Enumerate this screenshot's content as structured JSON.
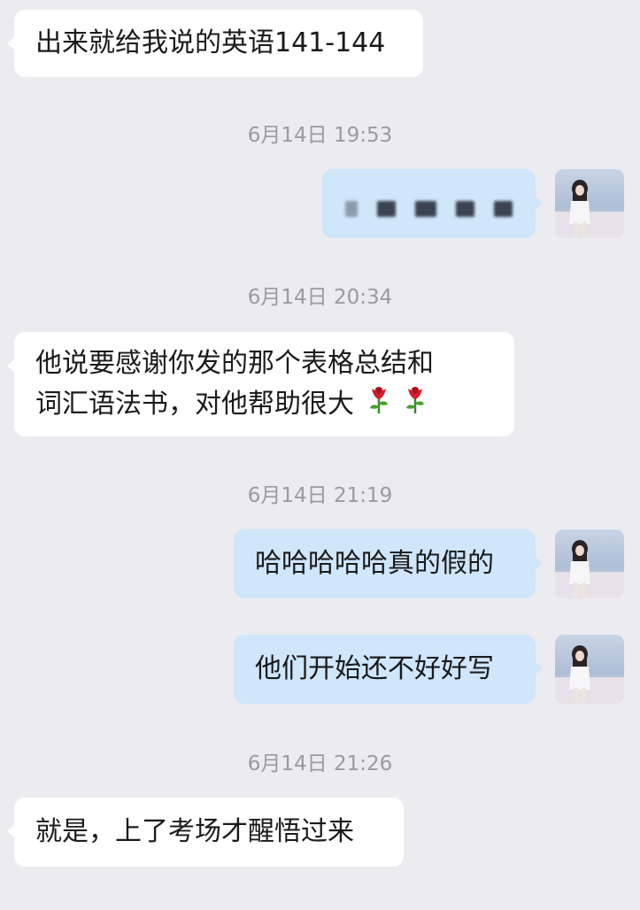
{
  "messages": [
    {
      "id": "m1",
      "side": "left",
      "lines": [
        "出来就给我说的英语141-144"
      ]
    },
    {
      "id": "t1",
      "type": "timestamp",
      "text": "6月14日 19:53"
    },
    {
      "id": "m2",
      "side": "right",
      "redacted": true
    },
    {
      "id": "t2",
      "type": "timestamp",
      "text": "6月14日 20:34"
    },
    {
      "id": "m3",
      "side": "left",
      "lines": [
        "他说要感谢你发的那个表格总结和",
        "词汇语法书，对他帮助很大"
      ],
      "emoji": [
        "rose-icon",
        "rose-icon"
      ]
    },
    {
      "id": "t3",
      "type": "timestamp",
      "text": "6月14日 21:19"
    },
    {
      "id": "m4",
      "side": "right",
      "lines": [
        "哈哈哈哈哈真的假的"
      ]
    },
    {
      "id": "m5",
      "side": "right",
      "lines": [
        "他们开始还不好好写"
      ]
    },
    {
      "id": "t4",
      "type": "timestamp",
      "text": "6月14日 21:26"
    },
    {
      "id": "m6",
      "side": "left",
      "lines": [
        "就是，上了考场才醒悟过来"
      ]
    }
  ],
  "colors": {
    "background": "#ebebf0",
    "left_bubble": "#ffffff",
    "right_bubble": "#cfe6fb",
    "timestamp": "#9a9aa0"
  }
}
